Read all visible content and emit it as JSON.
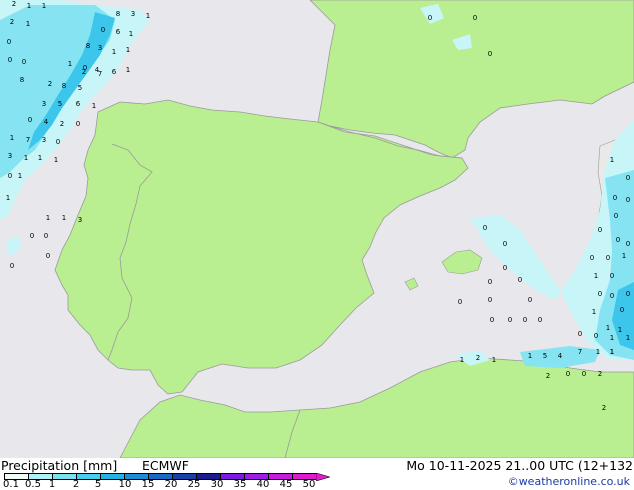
{
  "legend": {
    "title": "Precipitation [mm]",
    "model": "ECMWF",
    "datetime": "Mo 10-11-2025 21..00 UTC (12+132",
    "credit": "©weatheronline.co.uk",
    "ticks": [
      "0.1",
      "0.5",
      "1",
      "2",
      "5",
      "10",
      "15",
      "20",
      "25",
      "30",
      "35",
      "40",
      "45",
      "50"
    ],
    "scale_colors": [
      "#f0fcfc",
      "#b0f0f8",
      "#78e2f0",
      "#44d0ec",
      "#1eb4e4",
      "#1a8fd8",
      "#1c68c6",
      "#1c3ea8",
      "#1c1c90",
      "#7a1ce0",
      "#a01ce8",
      "#c81ae0",
      "#e01ad0"
    ]
  },
  "colors": {
    "sea": "#e8e8ec",
    "land": "#b9ef90",
    "outside_land": "#e9e9ea",
    "border": "#9a9a9a",
    "precip_light": "#c8f6f8",
    "precip_mid": "#86e4f2",
    "precip_heavy": "#3cc6ec"
  },
  "map_values": [
    "2",
    "1",
    "1",
    "2",
    "1",
    "0",
    "8",
    "3",
    "1",
    "0",
    "6",
    "1",
    "0",
    "0",
    "8",
    "3",
    "1",
    "1",
    "0",
    "4",
    "1",
    "2",
    "7",
    "6",
    "1",
    "8",
    "2",
    "8",
    "5",
    "3",
    "5",
    "6",
    "1",
    "0",
    "4",
    "2",
    "0",
    "1",
    "7",
    "3",
    "0",
    "3",
    "1",
    "1",
    "1",
    "0",
    "1",
    "1",
    "1",
    "3",
    "1",
    "0",
    "0",
    "0",
    "0",
    "0",
    "0",
    "0",
    "0",
    "0",
    "0",
    "0",
    "0",
    "0",
    "0",
    "0",
    "0",
    "0",
    "0",
    "0",
    "1",
    "0",
    "0",
    "0",
    "0",
    "0",
    "0",
    "0",
    "0",
    "0",
    "1",
    "1",
    "0",
    "0",
    "0",
    "0",
    "0",
    "1",
    "1",
    "1",
    "0",
    "0",
    "1",
    "1",
    "1",
    "1",
    "2",
    "1",
    "1",
    "5",
    "4",
    "7",
    "1",
    "1",
    "2",
    "0",
    "0",
    "2",
    "2",
    "0",
    "1",
    "0",
    "0",
    "1",
    "0",
    "0",
    "0",
    "0",
    "0",
    "0",
    "0",
    "0",
    "0"
  ]
}
